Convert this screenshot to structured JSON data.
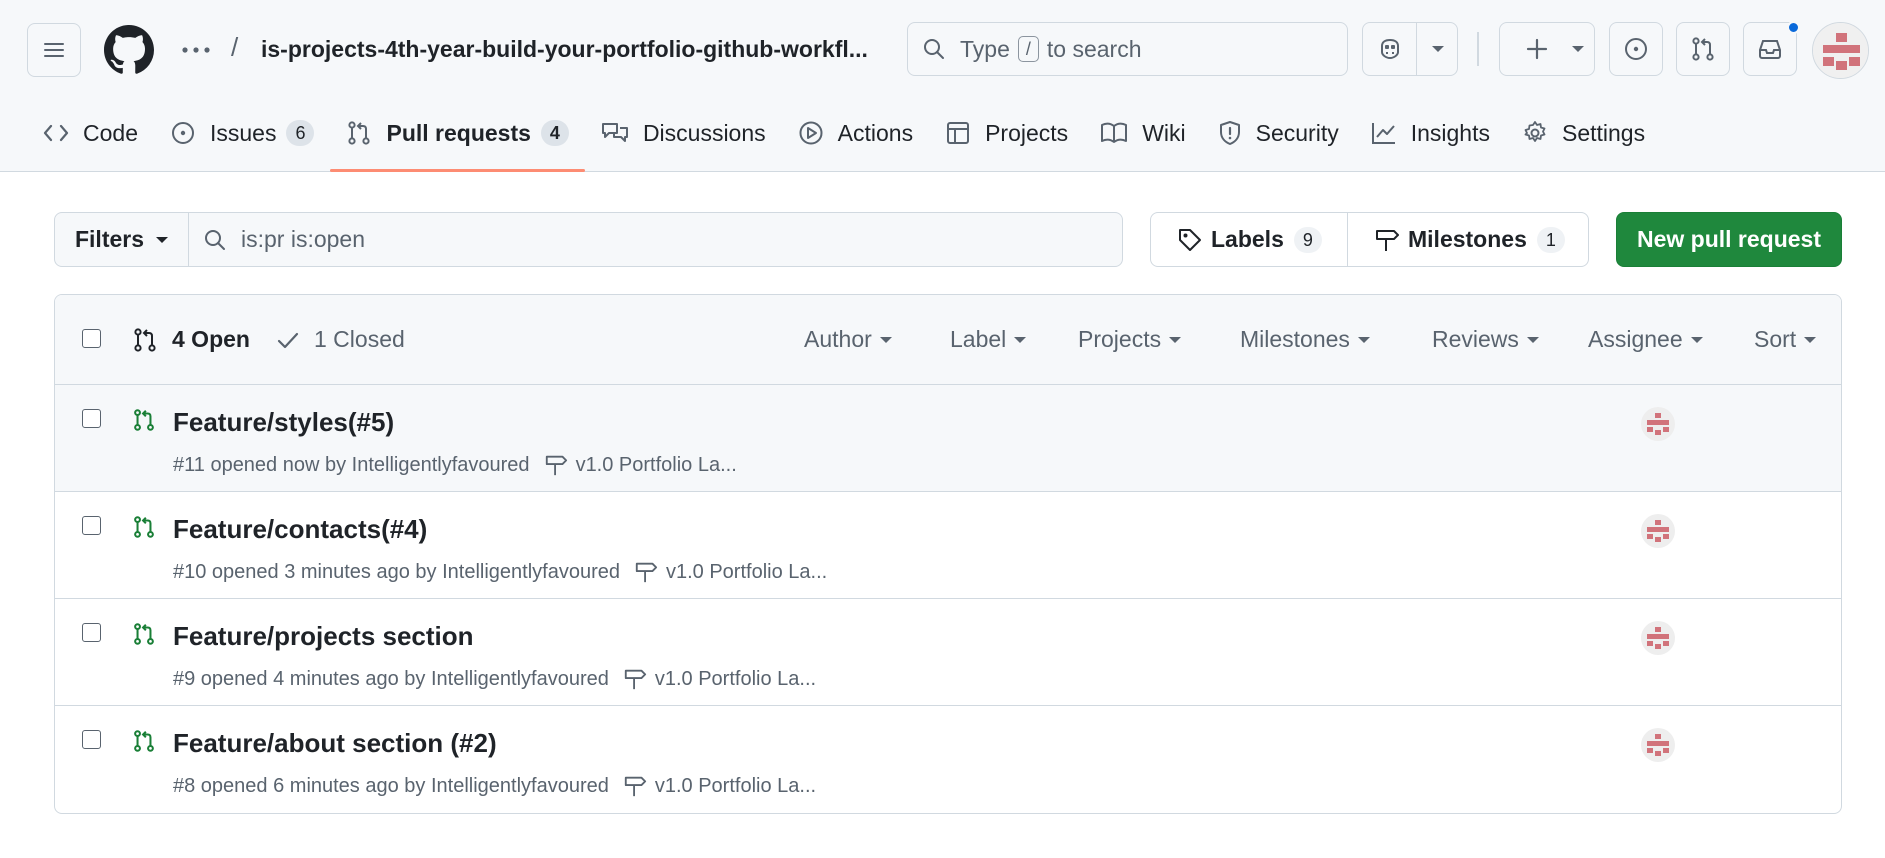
{
  "header": {
    "repo_title": "is-projects-4th-year-build-your-portfolio-github-workfl...",
    "separator": "/",
    "search": {
      "prefix": "Type",
      "key": "/",
      "suffix": "to search"
    },
    "notification_color": "#0969da"
  },
  "tabs": [
    {
      "label": "Code",
      "icon": "code-icon",
      "count": ""
    },
    {
      "label": "Issues",
      "icon": "issue-opened-icon",
      "count": "6"
    },
    {
      "label": "Pull requests",
      "icon": "git-pull-request-icon",
      "count": "4"
    },
    {
      "label": "Discussions",
      "icon": "comment-discussion-icon",
      "count": ""
    },
    {
      "label": "Actions",
      "icon": "play-icon",
      "count": ""
    },
    {
      "label": "Projects",
      "icon": "table-icon",
      "count": ""
    },
    {
      "label": "Wiki",
      "icon": "book-icon",
      "count": ""
    },
    {
      "label": "Security",
      "icon": "shield-icon",
      "count": ""
    },
    {
      "label": "Insights",
      "icon": "graph-icon",
      "count": ""
    },
    {
      "label": "Settings",
      "icon": "gear-icon",
      "count": ""
    }
  ],
  "subnav": {
    "filters_label": "Filters",
    "query": "is:pr is:open",
    "labels_label": "Labels",
    "labels_count": "9",
    "milestones_label": "Milestones",
    "milestones_count": "1",
    "new_pr_label": "New pull request",
    "accent": "#1f883d"
  },
  "list": {
    "open_label": "4 Open",
    "closed_label": "1 Closed",
    "selectors": [
      "Author",
      "Label",
      "Projects",
      "Milestones",
      "Reviews",
      "Assignee",
      "Sort"
    ],
    "items": [
      {
        "title": "Feature/styles(#5)",
        "meta": "#11 opened now by Intelligentlyfavoured",
        "milestone": "v1.0 Portfolio La..."
      },
      {
        "title": "Feature/contacts(#4)",
        "meta": "#10 opened 3 minutes ago by Intelligentlyfavoured",
        "milestone": "v1.0 Portfolio La..."
      },
      {
        "title": "Feature/projects section",
        "meta": "#9 opened 4 minutes ago by Intelligentlyfavoured",
        "milestone": "v1.0 Portfolio La..."
      },
      {
        "title": "Feature/about section (#2)",
        "meta": "#8 opened 6 minutes ago by Intelligentlyfavoured",
        "milestone": "v1.0 Portfolio La..."
      }
    ]
  }
}
